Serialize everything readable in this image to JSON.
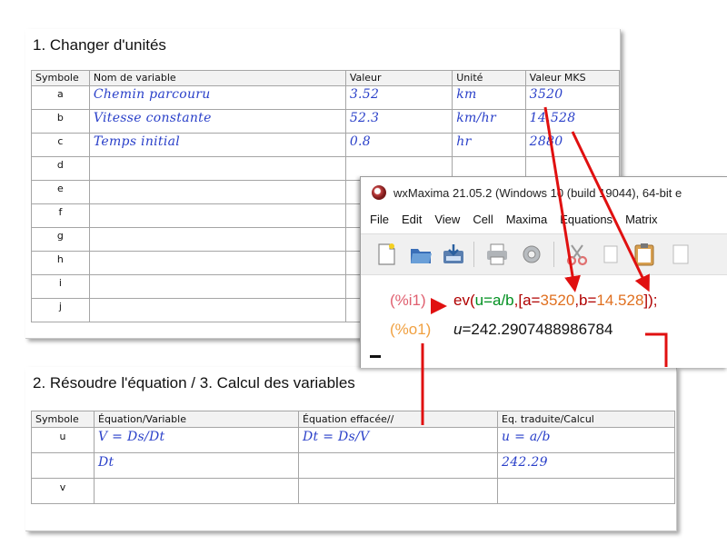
{
  "section1": {
    "title": "1. Changer d'unités",
    "headers": [
      "Symbole",
      "Nom de variable",
      "Valeur",
      "Unité",
      "Valeur MKS"
    ],
    "rows": [
      {
        "symbol": "a",
        "name": "Chemin parcouru",
        "value": "3.52",
        "unit": "km",
        "mks": "3520"
      },
      {
        "symbol": "b",
        "name": "Vitesse constante",
        "value": "52.3",
        "unit": "km/hr",
        "mks": "14.528"
      },
      {
        "symbol": "c",
        "name": "Temps initial",
        "value": "0.8",
        "unit": "hr",
        "mks": "2880"
      },
      {
        "symbol": "d",
        "name": "",
        "value": "",
        "unit": "",
        "mks": ""
      },
      {
        "symbol": "e",
        "name": "",
        "value": "",
        "unit": "",
        "mks": ""
      },
      {
        "symbol": "f",
        "name": "",
        "value": "",
        "unit": "",
        "mks": ""
      },
      {
        "symbol": "g",
        "name": "",
        "value": "",
        "unit": "",
        "mks": ""
      },
      {
        "symbol": "h",
        "name": "",
        "value": "",
        "unit": "",
        "mks": ""
      },
      {
        "symbol": "i",
        "name": "",
        "value": "",
        "unit": "",
        "mks": ""
      },
      {
        "symbol": "j",
        "name": "",
        "value": "",
        "unit": "",
        "mks": ""
      }
    ]
  },
  "section2": {
    "title": "2. Résoudre l'équation / 3. Calcul des variables",
    "headers": [
      "Symbole",
      "Équation/Variable",
      "Équation effacée//",
      "Eq. traduite/Calcul"
    ],
    "rows": [
      {
        "symbol": "u",
        "equation": "V = Ds/Dt",
        "erased": "Dt = Ds/V",
        "translated": "u = a/b"
      },
      {
        "symbol": "",
        "equation": "Dt",
        "erased": "",
        "translated": "242.29"
      },
      {
        "symbol": "v",
        "equation": "",
        "erased": "",
        "translated": ""
      }
    ]
  },
  "wxmaxima": {
    "title": "wxMaxima 21.05.2 (Windows 10 (build 19044), 64-bit e",
    "menu": [
      "File",
      "Edit",
      "View",
      "Cell",
      "Maxima",
      "Equations",
      "Matrix"
    ],
    "toolbar_icons": [
      "new-file-icon",
      "open-folder-icon",
      "save-icon",
      "print-icon",
      "settings-gear-icon",
      "cut-scissors-icon",
      "copy-icon",
      "paste-clipboard-icon"
    ],
    "input_prompt": "(%i1)",
    "input_code": {
      "p1": "ev(",
      "p2": "u=a/b",
      "p3": ",[a=",
      "p4": "3520",
      "p5": ",b=",
      "p6": "14.528",
      "p7": "]);"
    },
    "output_prompt": "(%o1)",
    "output_var": "u",
    "output_eq": "=242.2907488986784"
  },
  "colors": {
    "handwriting": "#2a40c9",
    "arrow": "#e01010",
    "prompt_input": "#e06070",
    "prompt_output": "#f0a040",
    "code_red": "#b00000",
    "code_green": "#009020",
    "code_orange": "#e07020"
  }
}
